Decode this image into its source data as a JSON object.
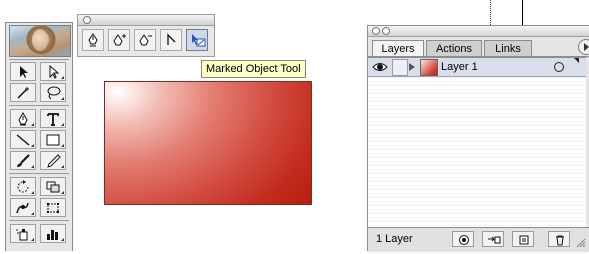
{
  "tooltip": {
    "text": "Marked Object Tool"
  },
  "pen_tearoff": {
    "tools": [
      {
        "icon": "pen-icon"
      },
      {
        "icon": "add-anchor-point-icon"
      },
      {
        "icon": "delete-anchor-point-icon"
      },
      {
        "icon": "convert-anchor-point-icon"
      },
      {
        "icon": "marked-object-icon",
        "active": true
      }
    ]
  },
  "tools_palette": {
    "tools": [
      "selection-icon",
      "direct-selection-icon",
      "magic-wand-icon",
      "lasso-icon",
      "pen-icon",
      "type-icon",
      "line-icon",
      "rectangle-icon",
      "paintbrush-icon",
      "pencil-icon",
      "rotate-icon",
      "scale-icon",
      "warp-icon",
      "free-transform-icon",
      "symbol-sprayer-icon",
      "graph-icon"
    ]
  },
  "layers_panel": {
    "tabs": [
      "Layers",
      "Actions",
      "Links"
    ],
    "active_tab": "Layers",
    "layers": [
      {
        "name": "Layer 1",
        "visible": true,
        "selected": true
      }
    ],
    "footer_count": "1 Layer",
    "footer_buttons": [
      "make-clipping-mask-icon",
      "create-sublayer-icon",
      "new-layer-icon",
      "trash-icon"
    ]
  },
  "colors": {
    "gradient_light": "#ffffff",
    "gradient_dark": "#b81f12",
    "selection_row": "#d9deeb",
    "tooltip_bg": "#ffffc8"
  }
}
